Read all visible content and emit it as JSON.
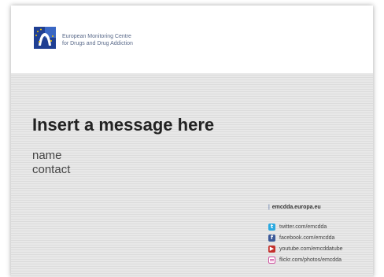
{
  "header": {
    "org_line1": "European Monitoring Centre",
    "org_line2": "for Drugs and Drug Addiction"
  },
  "main": {
    "title": "Insert a message here",
    "name": "name",
    "contact": "contact"
  },
  "footer": {
    "website": "emcdda.europa.eu",
    "social": [
      {
        "icon": "twitter-icon",
        "label": "twitter.com/emcdda",
        "color": "#2aa9e0"
      },
      {
        "icon": "facebook-icon",
        "label": "facebook.com/emcdda",
        "color": "#3b5998"
      },
      {
        "icon": "youtube-icon",
        "label": "youtube.com/emcddatube",
        "color": "#c4302b"
      },
      {
        "icon": "flickr-icon",
        "label": "flickr.com/photos/emcdda",
        "color": "#d14fa0"
      }
    ]
  },
  "colors": {
    "logo_blue": "#1f3f93",
    "logo_accent": "#f2c500"
  }
}
